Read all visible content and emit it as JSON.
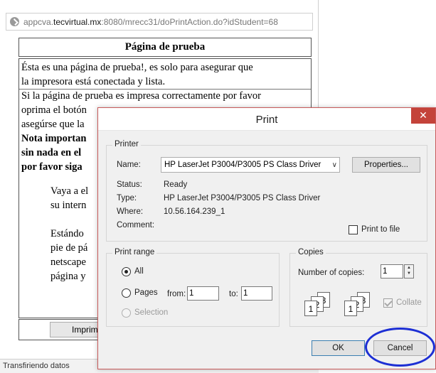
{
  "browser": {
    "url_prefix": "appcva.",
    "url_host": "tecvirtual.mx",
    "url_rest": ":8080/mrecc31/doPrintAction.do?idStudent=68",
    "page_title": "Página de prueba",
    "lines": [
      "Ésta es una página de prueba!, es solo para asegurar que",
      "la impresora está conectada y lista.",
      "Si la página de prueba es impresa correctamente por favor",
      "oprima el botón",
      "asegúrse que la",
      "Nota importan",
      "sin nada en el",
      "por favor siga",
      "Vaya a el",
      "su intern",
      "Estándo",
      "pie de pá",
      "netscape",
      "página y"
    ],
    "print_button": "Imprimi",
    "status": "Transfiriendo datos"
  },
  "dialog": {
    "title": "Print",
    "close_glyph": "✕",
    "printer_group": "Printer",
    "name_label": "Name:",
    "printer_name": "HP LaserJet P3004/P3005 PS Class Driver",
    "properties_button": "Properties...",
    "status_label": "Status:",
    "status_value": "Ready",
    "type_label": "Type:",
    "type_value": "HP LaserJet P3004/P3005 PS Class Driver",
    "where_label": "Where:",
    "where_value": "10.56.164.239_1",
    "comment_label": "Comment:",
    "print_to_file": "Print to file",
    "range_group": "Print range",
    "all_label": "All",
    "pages_label": "Pages",
    "from_label": "from:",
    "from_value": "1",
    "to_label": "to:",
    "to_value": "1",
    "selection_label": "Selection",
    "copies_group": "Copies",
    "copies_label": "Number of copies:",
    "copies_value": "1",
    "collate_label": "Collate",
    "ok_button": "OK",
    "cancel_button": "Cancel"
  }
}
